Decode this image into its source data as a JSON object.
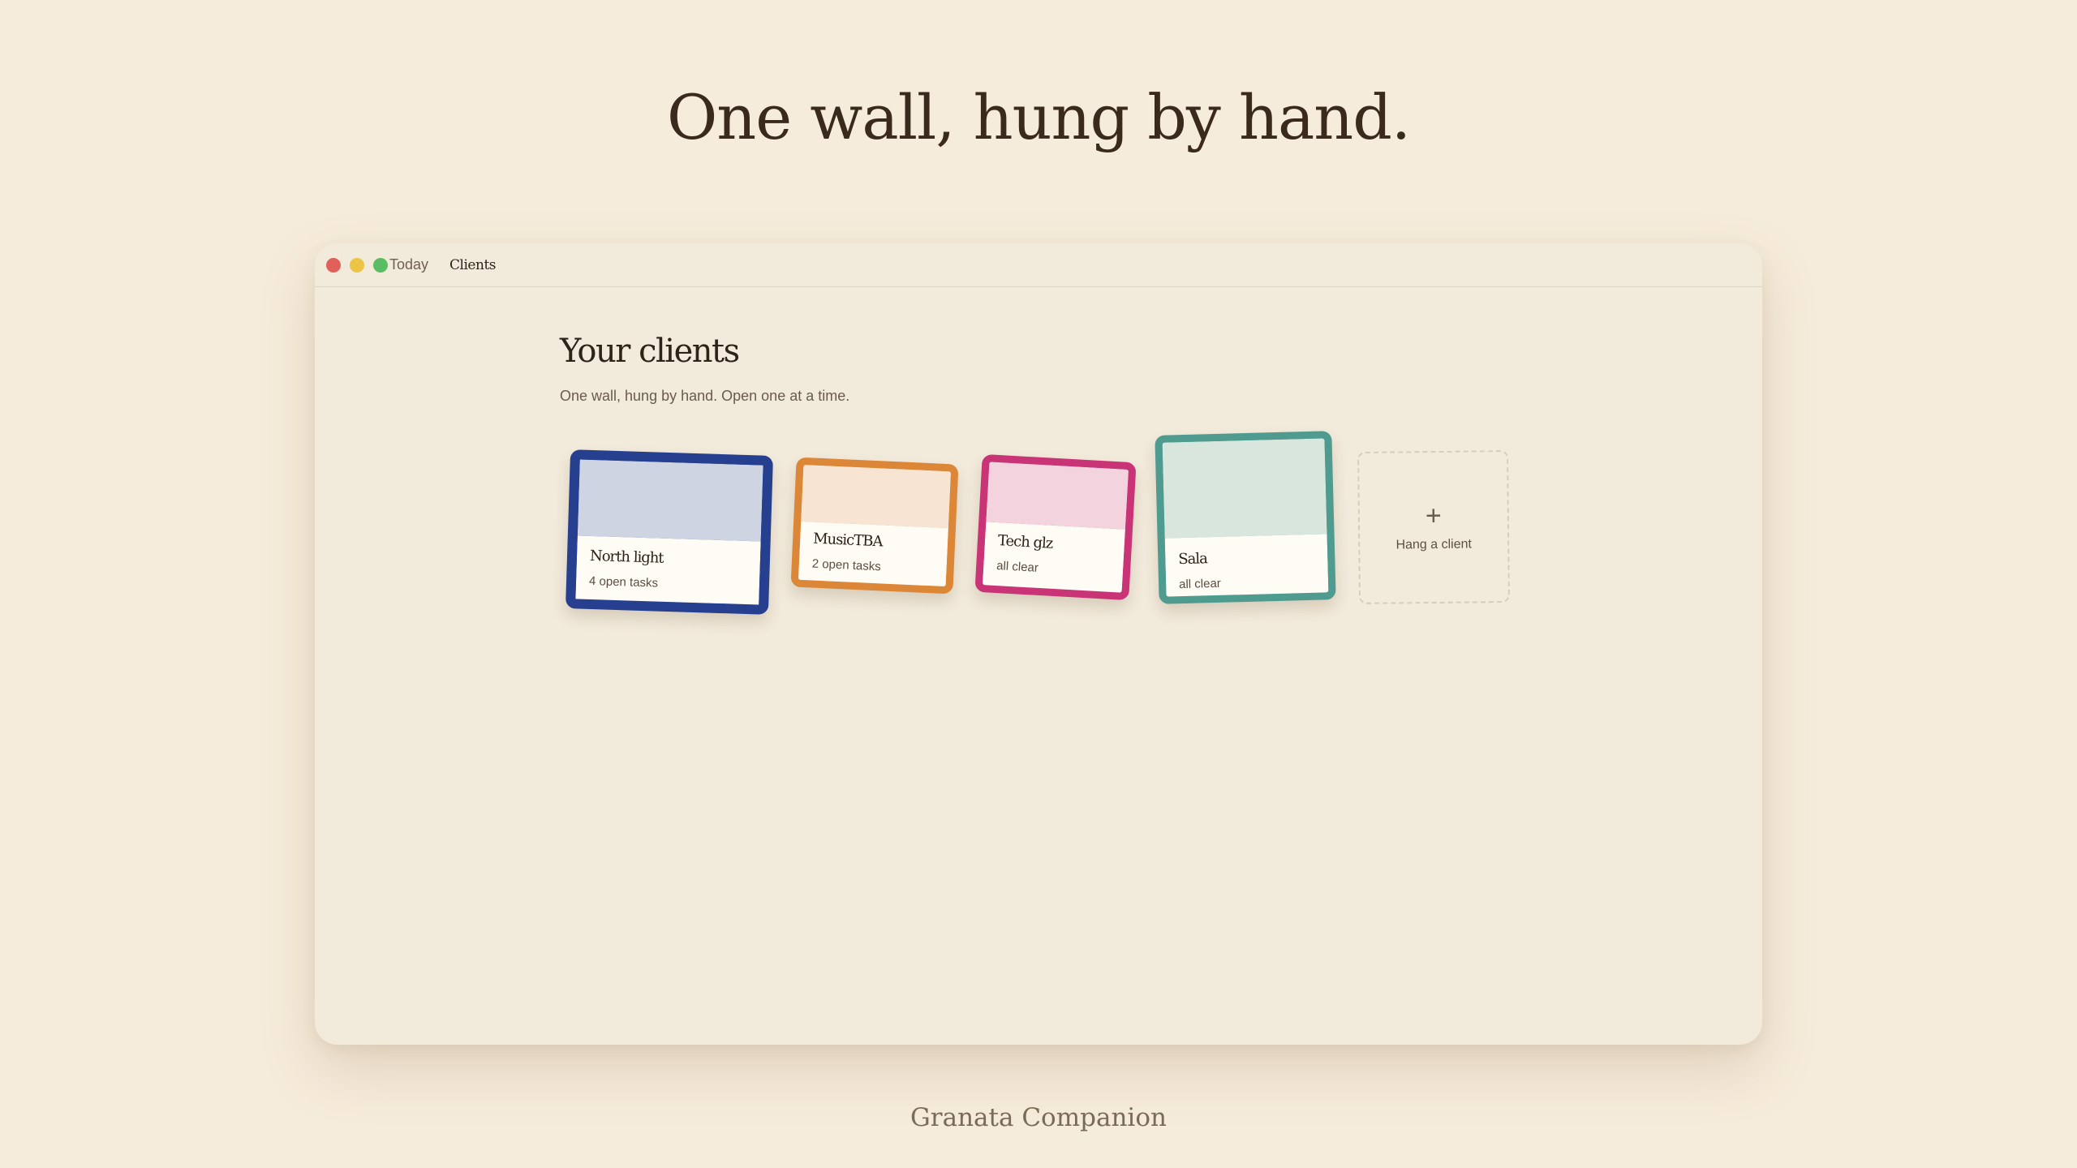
{
  "hero": {
    "title": "One wall, hung by hand."
  },
  "window": {
    "nav": {
      "today": "Today",
      "clients": "Clients"
    }
  },
  "page": {
    "title": "Your clients",
    "subtitle": "One wall, hung by hand. Open one at a time."
  },
  "clients": [
    {
      "name": "North light",
      "status": "4 open tasks",
      "color": "#26408f",
      "swatch": "#cfd4e3"
    },
    {
      "name": "MusicTBA",
      "status": "2 open tasks",
      "color": "#dc8737",
      "swatch": "#f7e4d2"
    },
    {
      "name": "Tech glz",
      "status": "all clear",
      "color": "#c93476",
      "swatch": "#f2d3de"
    },
    {
      "name": "Sala",
      "status": "all clear",
      "color": "#4f9b90",
      "swatch": "#d8e6dd"
    }
  ],
  "add_client": {
    "icon": "plus-icon",
    "label": "Hang a client"
  },
  "footer": {
    "text": "Granata Companion"
  }
}
